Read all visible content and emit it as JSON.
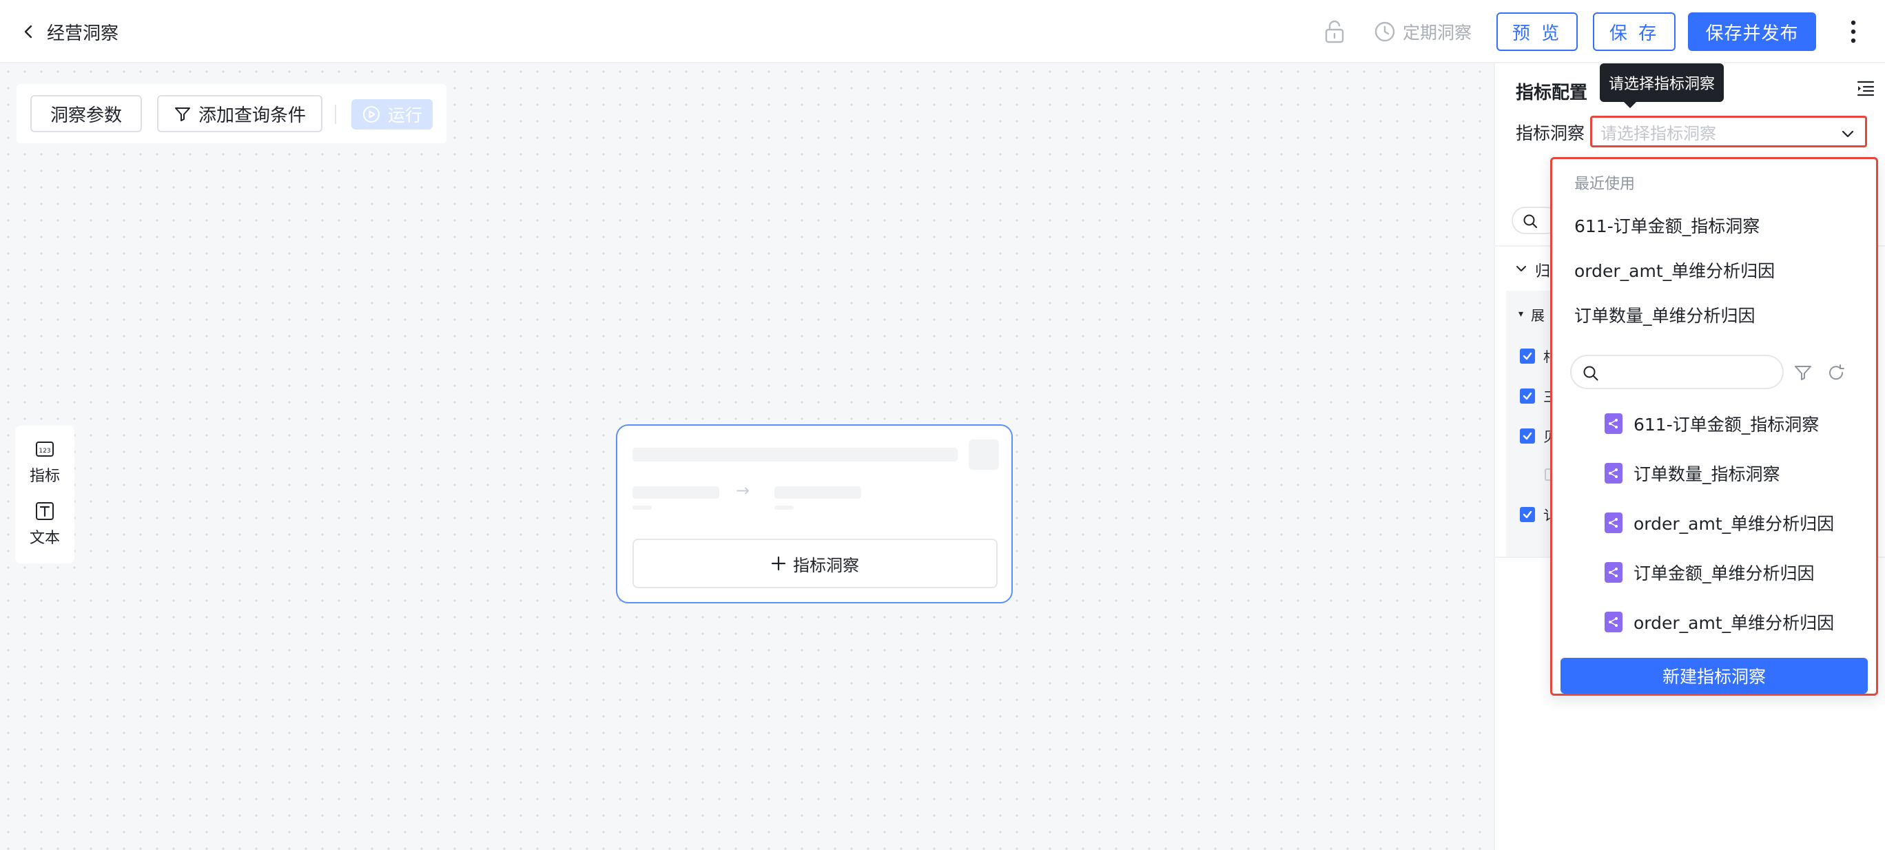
{
  "header": {
    "back_icon": "chevron-left-icon",
    "title": "经营洞察",
    "schedule_label": "定期洞察",
    "preview_label": "预 览",
    "save_label": "保 存",
    "publish_label": "保存并发布"
  },
  "toolbar": {
    "params_label": "洞察参数",
    "filter_label": "添加查询条件",
    "run_label": "运行"
  },
  "side_tools": [
    {
      "label": "指标",
      "icon": "metric-icon"
    },
    {
      "label": "文本",
      "icon": "text-icon"
    }
  ],
  "node": {
    "add_label": "指标洞察"
  },
  "right_panel": {
    "title": "指标配置",
    "field_label": "指标洞察",
    "select_placeholder": "请选择指标洞察",
    "bg_texts": [
      "归",
      "展",
      "村",
      "三",
      "贝",
      "讠"
    ]
  },
  "tooltip": {
    "text": "请选择指标洞察"
  },
  "dropdown": {
    "recent_title": "最近使用",
    "recent_items": [
      "611-订单金额_指标洞察",
      "order_amt_单维分析归因",
      "订单数量_单维分析归因"
    ],
    "search_placeholder": "",
    "items": [
      "611-订单金额_指标洞察",
      "订单数量_指标洞察",
      "order_amt_单维分析归因",
      "订单金额_单维分析归因",
      "order_amt_单维分析归因"
    ],
    "create_label": "新建指标洞察"
  },
  "colors": {
    "primary": "#3370ff",
    "highlight_border": "#e5473f",
    "item_icon": "#8b6cf0",
    "tooltip_bg": "#1f2329"
  }
}
